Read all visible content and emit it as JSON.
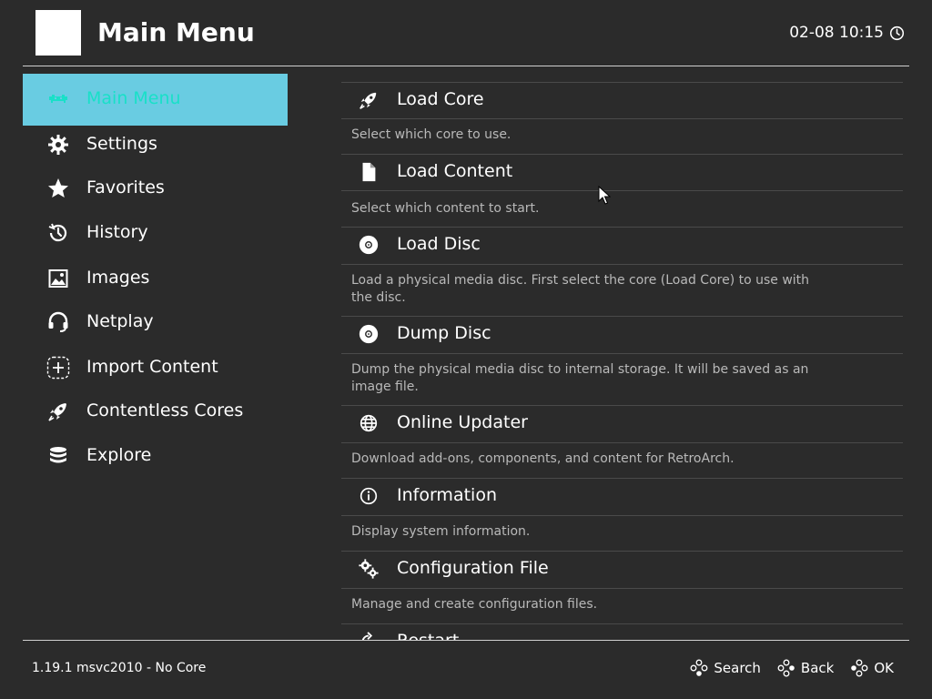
{
  "header": {
    "title": "Main Menu",
    "clock": "02-08 10:15"
  },
  "sidebar": {
    "items": [
      {
        "label": "Main Menu",
        "icon": "retroarch-invader-icon",
        "active": true
      },
      {
        "label": "Settings",
        "icon": "gear-icon"
      },
      {
        "label": "Favorites",
        "icon": "star-icon"
      },
      {
        "label": "History",
        "icon": "history-icon"
      },
      {
        "label": "Images",
        "icon": "image-icon"
      },
      {
        "label": "Netplay",
        "icon": "headset-icon"
      },
      {
        "label": "Import Content",
        "icon": "plus-icon"
      },
      {
        "label": "Contentless Cores",
        "icon": "rocket-icon"
      },
      {
        "label": "Explore",
        "icon": "database-icon"
      }
    ]
  },
  "main": {
    "entries": [
      {
        "label": "Load Core",
        "icon": "rocket-icon",
        "desc": "Select which core to use."
      },
      {
        "label": "Load Content",
        "icon": "file-icon",
        "desc": "Select which content to start."
      },
      {
        "label": "Load Disc",
        "icon": "disc-icon",
        "desc": "Load a physical media disc. First select the core (Load Core) to use with the disc."
      },
      {
        "label": "Dump Disc",
        "icon": "disc-icon",
        "desc": "Dump the physical media disc to internal storage. It will be saved as an image file."
      },
      {
        "label": "Online Updater",
        "icon": "globe-icon",
        "desc": "Download add-ons, components, and content for RetroArch."
      },
      {
        "label": "Information",
        "icon": "info-icon",
        "desc": "Display system information."
      },
      {
        "label": "Configuration File",
        "icon": "gears-icon",
        "desc": "Manage and create configuration files."
      },
      {
        "label": "Restart",
        "icon": "restart-icon",
        "desc": ""
      }
    ]
  },
  "footer": {
    "version": "1.19.1 msvc2010 - No Core",
    "actions": [
      {
        "label": "Search",
        "icon": "gamepad-buttons-icon"
      },
      {
        "label": "Back",
        "icon": "gamepad-buttons-icon"
      },
      {
        "label": "OK",
        "icon": "gamepad-buttons-icon"
      }
    ]
  },
  "colors": {
    "background": "#2b2b2b",
    "active_bg": "#69cce2",
    "active_text": "#19e0c8",
    "description": "#b9b9b9"
  }
}
